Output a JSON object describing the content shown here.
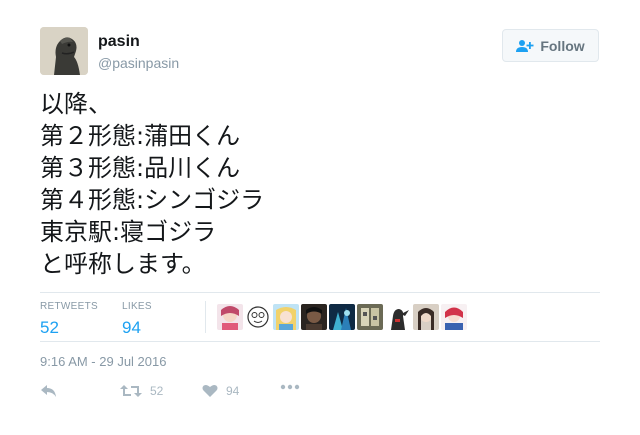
{
  "user": {
    "name": "pasin",
    "handle": "@pasinpasin",
    "avatar_icon": "godzilla-avatar"
  },
  "follow": {
    "label": "Follow",
    "icon": "add-user-icon"
  },
  "tweet": {
    "lines": [
      "以降、",
      "第２形態:蒲田くん",
      "第３形態:品川くん",
      "第４形態:シンゴジラ",
      "東京駅:寝ゴジラ",
      "と呼称します。"
    ]
  },
  "stats": {
    "retweets_label": "RETWEETS",
    "retweets_count": "52",
    "likes_label": "LIKES",
    "likes_count": "94"
  },
  "timestamp": "9:16 AM - 29 Jul 2016",
  "actions": {
    "reply_icon": "reply-icon",
    "retweet_icon": "retweet-icon",
    "retweet_count": "52",
    "like_icon": "heart-icon",
    "like_count": "94",
    "more_icon": "more-dots-icon"
  },
  "colors": {
    "accent": "#1da1f2",
    "muted": "#8899a6",
    "border": "#e1e8ed",
    "text": "#14171a"
  }
}
